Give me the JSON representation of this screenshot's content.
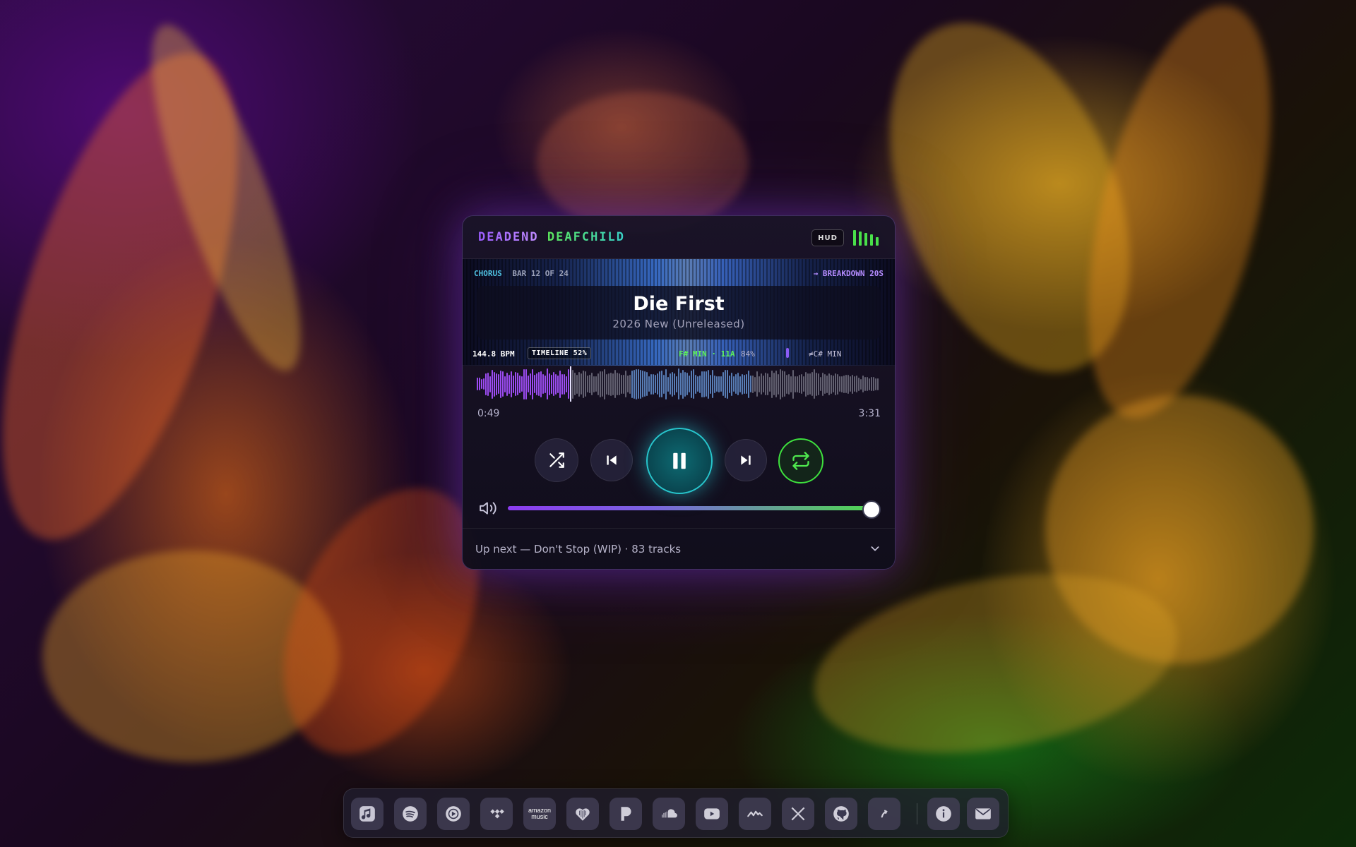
{
  "player": {
    "brand_part1": "DEADEND",
    "brand_part2": "DEAFCHILD",
    "hud_label": "HUD",
    "section": "CHORUS",
    "bar_info": "BAR 12 OF 24",
    "next_section": "→ BREAKDOWN 20S",
    "track_title": "Die First",
    "track_subtitle": "2026 New (Unreleased)",
    "bpm": "144.8 BPM",
    "timeline": "TIMELINE 52%",
    "key": "F# MIN · 11A",
    "key_confidence": "84%",
    "compatible_key": "≠C# MIN",
    "time_current": "0:49",
    "time_duration": "3:31",
    "playback_progress": 0.23,
    "volume": 0.97,
    "up_next": "Up next — Don't Stop (WIP) · 83 tracks",
    "colors": {
      "accent_purple": "#9b5cff",
      "accent_green": "#49e04a",
      "accent_teal": "#27c5cc"
    }
  },
  "controls": {
    "shuffle_icon": "shuffle-icon",
    "prev_icon": "skip-back-icon",
    "play_pause_icon": "pause-icon",
    "next_icon": "skip-forward-icon",
    "repeat_icon": "repeat-icon",
    "volume_icon": "speaker-icon",
    "expand_icon": "chevron-down-icon"
  },
  "dock": {
    "amazon_line1": "amazon",
    "amazon_line2": "music",
    "items": [
      "apple-music-icon",
      "spotify-icon",
      "youtube-music-icon",
      "tidal-icon",
      "amazon-music-icon",
      "deezer-icon",
      "pandora-icon",
      "soundcloud-icon",
      "youtube-icon",
      "audiomack-icon",
      "x-icon",
      "github-icon",
      "linktree-icon",
      "info-icon",
      "mail-icon"
    ]
  }
}
